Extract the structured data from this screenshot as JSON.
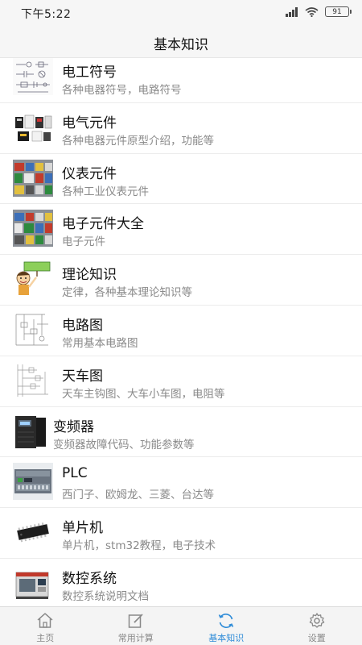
{
  "status_bar": {
    "time": "下午5:22",
    "battery": "91"
  },
  "header": {
    "title": "基本知识"
  },
  "list": {
    "items": [
      {
        "title": "电工符号",
        "subtitle": "各种电器符号，电路符号",
        "icon": "circuit-symbols-thumbnail"
      },
      {
        "title": "电气元件",
        "subtitle": "各种电器元件原型介绍，功能等",
        "icon": "electrical-components-thumbnail"
      },
      {
        "title": "仪表元件",
        "subtitle": "各种工业仪表元件",
        "icon": "instrument-components-thumbnail"
      },
      {
        "title": "电子元件大全",
        "subtitle": "电子元件",
        "icon": "electronic-components-thumbnail"
      },
      {
        "title": "理论知识",
        "subtitle": "定律，各种基本理论知识等",
        "icon": "cartoon-teacher-thumbnail"
      },
      {
        "title": "电路图",
        "subtitle": "常用基本电路图",
        "icon": "circuit-diagram-thumbnail"
      },
      {
        "title": "天车图",
        "subtitle": "天车主钩图、大车小车图，电阻等",
        "icon": "crane-diagram-thumbnail"
      },
      {
        "title": "变频器",
        "subtitle": "变频器故障代码、功能参数等",
        "icon": "inverter-thumbnail"
      },
      {
        "title": "PLC",
        "subtitle": "西门子、欧姆龙、三菱、台达等",
        "icon": "plc-thumbnail"
      },
      {
        "title": "单片机",
        "subtitle": "单片机，stm32教程，电子技术",
        "icon": "microcontroller-chip-thumbnail"
      },
      {
        "title": "数控系统",
        "subtitle": "数控系统说明文档",
        "icon": "cnc-machine-thumbnail"
      }
    ]
  },
  "tabs": [
    {
      "label": "主页",
      "icon": "home-icon",
      "active": false
    },
    {
      "label": "常用计算",
      "icon": "edit-icon",
      "active": false
    },
    {
      "label": "基本知识",
      "icon": "refresh-icon",
      "active": true
    },
    {
      "label": "设置",
      "icon": "gear-icon",
      "active": false
    }
  ],
  "colors": {
    "accent": "#2f8cd8",
    "bar_bg": "#f6f6f6",
    "subtitle": "#8a8a8a"
  }
}
